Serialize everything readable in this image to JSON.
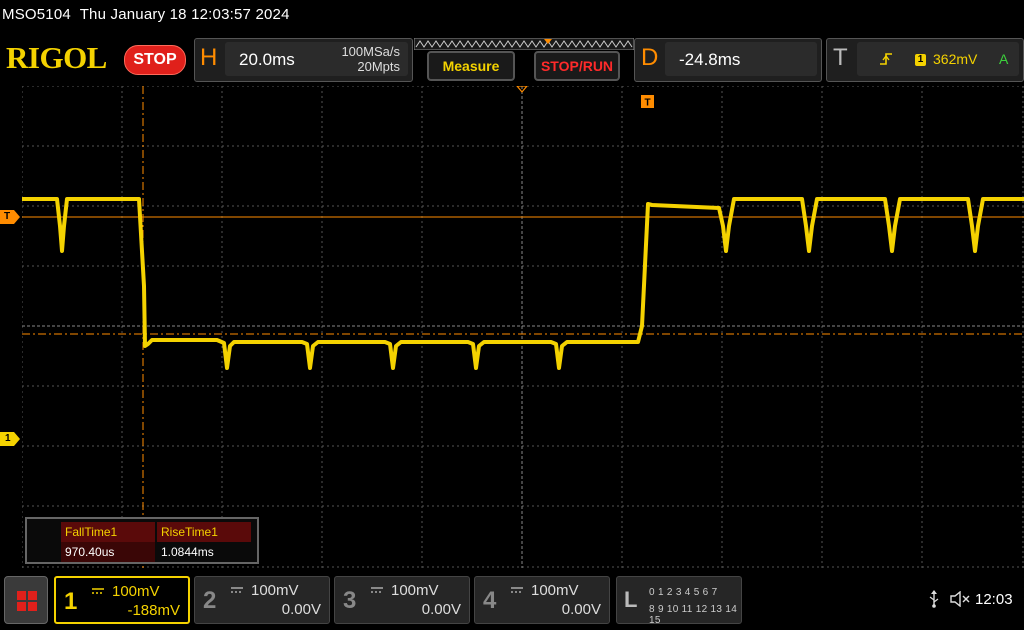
{
  "title_bar": {
    "model": "MSO5104",
    "datetime": "Thu January 18 12:03:57 2024"
  },
  "brand": {
    "logo_text": "RIGOL",
    "run_state": "STOP"
  },
  "horizontal": {
    "letter": "H",
    "timebase": "20.0ms",
    "sample_rate": "100MSa/s",
    "memory_depth": "20Mpts"
  },
  "buttons": {
    "measure": "Measure",
    "stop_run": "STOP/RUN"
  },
  "delay": {
    "letter": "D",
    "value": "-24.8ms"
  },
  "trigger": {
    "letter": "T",
    "source": "1",
    "level": "362mV",
    "mode": "A",
    "edge_icon": "rising-edge-icon"
  },
  "markers": {
    "trigger_level": "T",
    "channel1_ground": "1",
    "trigger_position": "T"
  },
  "measurements": {
    "headers": [
      "FallTime1",
      "RiseTime1"
    ],
    "values": [
      "970.40us",
      "1.0844ms"
    ]
  },
  "channels": [
    {
      "num": "1",
      "scale": "100mV",
      "offset": "-188mV",
      "active": true
    },
    {
      "num": "2",
      "scale": "100mV",
      "offset": "0.00V",
      "active": false
    },
    {
      "num": "3",
      "scale": "100mV",
      "offset": "0.00V",
      "active": false
    },
    {
      "num": "4",
      "scale": "100mV",
      "offset": "0.00V",
      "active": false
    }
  ],
  "logic": {
    "letter": "L",
    "row1": "0 1 2 3  4 5 6 7",
    "row2": "8 9 10 11 12 13 14 15"
  },
  "status": {
    "usb_icon": "usb-icon",
    "sound_icon": "mute-icon",
    "time": "12:03"
  },
  "colors": {
    "channel1": "#f4d200",
    "accent": "#ff8c00",
    "stop": "#e0201b",
    "grid": "#6a6a6a",
    "trigger_line": "#ff8c00"
  }
}
